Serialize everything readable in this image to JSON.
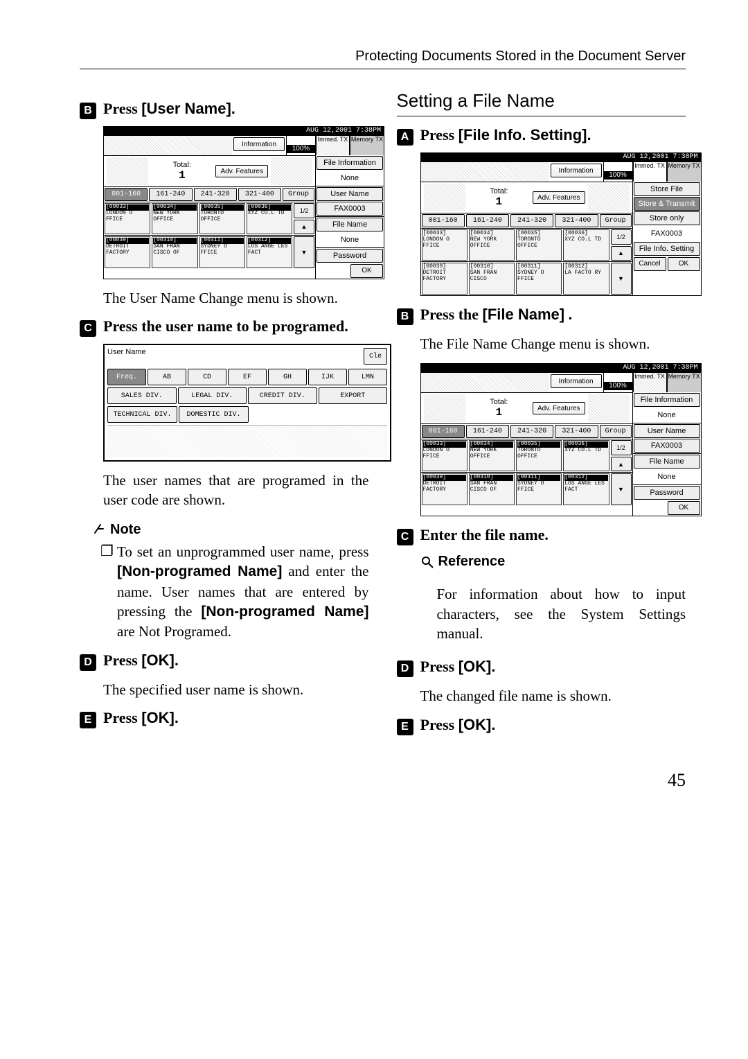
{
  "header": {
    "title": "Protecting Documents Stored in the Document Server"
  },
  "page_number": "45",
  "left": {
    "step_b_prefix": "Press ",
    "step_b_action": "[User Name].",
    "panel_a_caption": "The User Name Change menu is shown.",
    "step_c_text": "Press the user name to be programed.",
    "panel_b_caption": "The user names that are programed in the user code are shown.",
    "note_label": "Note",
    "note_a_pre": "To set an unprogrammed user name, press ",
    "note_a_bold1": "[Non-programed Name]",
    "note_a_mid": " and enter the name. User names that are entered by pressing the ",
    "note_a_bold2": "[Non-programed Name]",
    "note_a_post": " are Not Programed.",
    "step_d_prefix": "Press ",
    "step_d_action": "[OK].",
    "step_d_caption": "The specified user name is shown.",
    "step_e_prefix": "Press ",
    "step_e_action": "[OK]."
  },
  "right": {
    "heading": "Setting a File Name",
    "step_a_prefix": "Press ",
    "step_a_action": "[File Info. Setting].",
    "step_b_prefix": "Press the ",
    "step_b_action": "[File Name]",
    "step_b_suffix": " .",
    "panel_b_caption": "The File Name Change menu is shown.",
    "step_c_text": "Enter the file name.",
    "ref_label": "Reference",
    "ref_text": "For information about how to input characters, see the System Settings manual.",
    "step_d_prefix": "Press ",
    "step_d_action": "[OK].",
    "step_d_caption": "The changed file name is shown.",
    "step_e_prefix": "Press ",
    "step_e_action": "[OK]."
  },
  "fax": {
    "status_date": "AUG  12,2001  7:38PM",
    "info_btn": "Information",
    "immed_label": "Immed.\nTX",
    "memory_label": "Memory\nTX",
    "mem_pct": "100%",
    "total_label": "Total:",
    "total_value": "1",
    "adv_btn": "Adv. Features",
    "ranges": [
      "001-160",
      "161-240",
      "241-320",
      "321-400"
    ],
    "group_btn": "Group",
    "page_indicator": "1/2",
    "arrow_up": "▲",
    "arrow_down": "▼",
    "slots_row1": [
      {
        "code": "[00033]",
        "body": "LONDON O\nFFICE"
      },
      {
        "code": "[00034]",
        "body": "NEW YORK\n OFFICE"
      },
      {
        "code": "[00035]",
        "body": "TORONTO\nOFFICE"
      },
      {
        "code": "[00036]",
        "body": "XYZ CO.L\nTD"
      }
    ],
    "slots_row2": [
      {
        "code": "[00039]",
        "body": "DETROIT\nFACTORY"
      },
      {
        "code": "[00310]",
        "body": "SAN FRAN\nCISCO OF"
      },
      {
        "code": "[00311]",
        "body": "SYDNEY O\nFFICE"
      },
      {
        "code": "[00312]",
        "body": "LOS ANGE\nLES FACT"
      }
    ],
    "slots_row2b": [
      {
        "code": "[00039]",
        "body": "DETROIT\nFACTORY"
      },
      {
        "code": "[00310]",
        "body": "SAN FRAN\nCISCO"
      },
      {
        "code": "[00311]",
        "body": "SYDNEY O\nFFICE"
      },
      {
        "code": "[00312]",
        "body": "LA FACTO\nRY"
      }
    ],
    "side_a": {
      "label1": "File Information",
      "value1": "None",
      "label2": "User Name",
      "value2_btn": "FAX0003",
      "label3": "File Name",
      "value3": "None",
      "label4": "Password",
      "ok": "OK"
    },
    "side_b": {
      "top_btn": "Store File",
      "store_tx": "Store & Transmit",
      "store_only": "Store only",
      "value2_btn": "FAX0003",
      "file_info": "File Info. Setting",
      "cancel": "Cancel",
      "ok": "OK"
    },
    "side_c": {
      "label1": "File Information",
      "value1": "None",
      "label2": "User Name",
      "value2_btn": "FAX0003",
      "label3": "File Name",
      "value3": "None",
      "label4": "Password",
      "ok": "OK"
    }
  },
  "name_table": {
    "title": "User Name",
    "cle": "Cle",
    "headers": [
      "Freq.",
      "AB",
      "CD",
      "EF",
      "GH",
      "IJK",
      "LMN"
    ],
    "row2": [
      "SALES DIV.",
      "LEGAL DIV.",
      "CREDIT DIV.",
      "EXPORT"
    ],
    "row3": [
      "TECHNICAL DIV.",
      "DOMESTIC DIV."
    ]
  }
}
